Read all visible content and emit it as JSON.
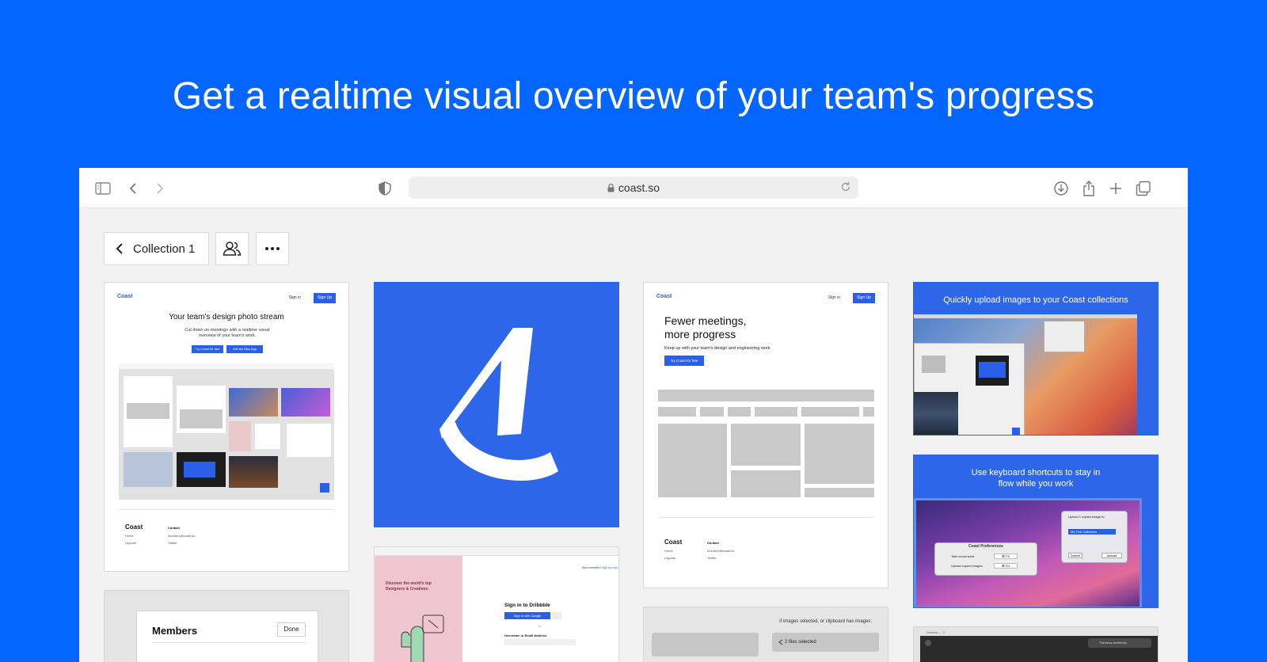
{
  "headline": "Get a realtime visual overview of your team's progress",
  "browser": {
    "url": "coast.so",
    "icons": [
      "sidebar-icon",
      "back-icon",
      "forward-icon",
      "privacy-icon",
      "lock-icon",
      "reload-icon",
      "download-icon",
      "share-icon",
      "new-tab-icon",
      "tabs-icon"
    ]
  },
  "toolbar": {
    "collection_label": "Collection 1",
    "members_icon": "people-icon",
    "more_icon": "ellipsis-icon"
  },
  "cards": {
    "card1": {
      "logo": "Coast",
      "signin": "Sign in",
      "signup": "Sign Up",
      "title": "Your team's design photo stream",
      "subtitle": "Cut down on meetings with a realtime visual overview of your team's work.",
      "btn1": "Try Coast for free",
      "btn2": "Get the Mac App",
      "footer_brand": "Coast",
      "footer_contact": "Contact",
      "footer_links": [
        "Home",
        "Layouts"
      ],
      "footer_contacts": [
        "founders@coast.so",
        "Twitter"
      ]
    },
    "card3": {
      "logo": "Coast",
      "signin": "Sign in",
      "signup": "Sign Up",
      "title_line1": "Fewer meetings,",
      "title_line2": "more progress",
      "subtitle": "Keep up with your team's design and engineering work",
      "btn": "Try Coast for free",
      "footer_brand": "Coast",
      "footer_contact": "Contact",
      "footer_links": [
        "Home",
        "Layouts"
      ],
      "footer_contacts": [
        "founders@coast.so",
        "Twitter"
      ]
    },
    "card4": {
      "title": "Quickly upload images to your Coast collections"
    },
    "card5": {
      "title_line1": "Use keyboard shortcuts to stay in",
      "title_line2": "flow while you work",
      "dialog_title": "Coast Preferences",
      "row1_label": "Take screenshot",
      "row1_value": "⌘⇧S",
      "row2_label": "Upload copied images",
      "row2_value": "⌘⇧U",
      "popup_title": "Upload 1 copied image to:",
      "popup_item": "My First Collection",
      "popup_cancel": "Cancel",
      "popup_upload": "Upload"
    },
    "card6": {
      "title": "Members",
      "done": "Done"
    },
    "card7": {
      "tagline": "Discover the world's top Designers & Creatives.",
      "signin_title": "Sign in to Dribbble",
      "google_btn": "Sign in with Google",
      "or": "or",
      "field_label": "Username or Email Address",
      "not_member": "Not a member?",
      "signup_now": "Sign up now"
    },
    "card8": {
      "hint": "if images selected, or clipboard has images:",
      "files": "2 files selected"
    },
    "card9": {
      "window_title": "Desktop — 2",
      "notification": "Thinness Architects"
    }
  },
  "colors": {
    "background": "#0566FF",
    "accent": "#2E66EA",
    "surface": "#F2F2F2"
  }
}
